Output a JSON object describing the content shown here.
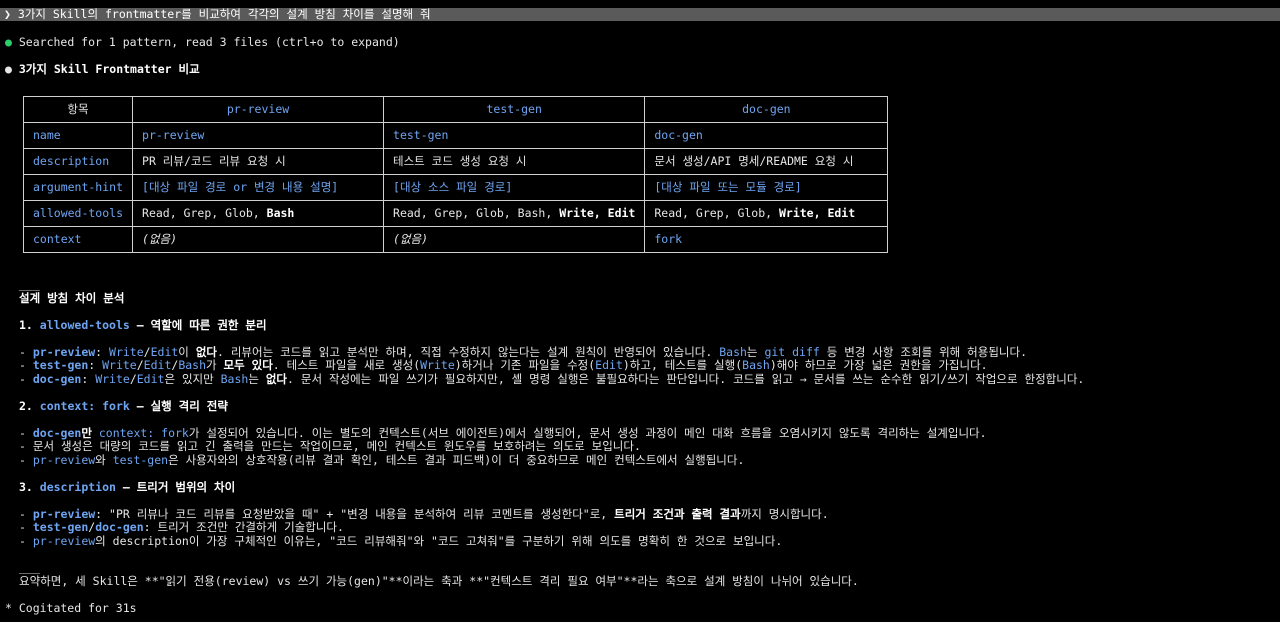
{
  "prompt": "❯ 3가지 Skill의 frontmatter를 비교하여 각각의 설계 방침 차이를 설명해 줘",
  "status_line": "Searched for 1 pattern, read 3 files (ctrl+o to expand)",
  "heading": "3가지 Skill Frontmatter 비교",
  "table": {
    "headers": [
      "항목",
      "pr-review",
      "test-gen",
      "doc-gen"
    ],
    "rows": [
      {
        "key": "name",
        "cells": [
          "pr-review",
          "test-gen",
          "doc-gen"
        ]
      },
      {
        "key": "description",
        "cells": [
          "PR 리뷰/코드 리뷰 요청 시",
          "테스트 코드 생성 요청 시",
          "문서 생성/API 명세/README 요청 시"
        ]
      },
      {
        "key": "argument-hint",
        "cells": [
          "[대상 파일 경로 or 변경 내용 설명]",
          "[대상 소스 파일 경로]",
          "[대상 파일 또는 모듈 경로]"
        ]
      },
      {
        "key": "allowed-tools",
        "cells": [
          "Read, Grep, Glob, ",
          "Read, Grep, Glob, Bash, ",
          "Read, Grep, Glob, "
        ],
        "bold": [
          "Bash",
          "Write, Edit",
          "Write, Edit"
        ]
      },
      {
        "key": "context",
        "cells": [
          "(없음)",
          "(없음)",
          "fork"
        ]
      }
    ]
  },
  "rule": "___",
  "section_title": "설계 방침 차이 분석",
  "s1": {
    "num": "1. ",
    "key": "allowed-tools",
    "title": " — 역할에 따른 권한 분리",
    "l1": {
      "a": "pr-review",
      "b": "Write",
      "c": "Edit",
      "d": "이 ",
      "e": "없다",
      "f": ". 리뷰어는 코드를 읽고 분석만 하며, 직접 수정하지 않는다는 설계 원칙이 반영되어 있습니다. ",
      "g": "Bash",
      "h": "는 ",
      "i": "git diff",
      "j": " 등 변경 사항 조회를 위해 허용됩니다."
    },
    "l2": {
      "a": "test-gen",
      "b": "Write",
      "c": "Edit",
      "d": "Bash",
      "e": "가 ",
      "f": "모두 있다",
      "g": ". 테스트 파일을 새로 생성(",
      "h": "Write",
      "i": ")하거나 기존 파일을 수정(",
      "j": "Edit",
      "k": ")하고, 테스트를 실행(",
      "l": "Bash",
      "m": ")해야 하므로 가장 넓은 권한을 가집니다."
    },
    "l3": {
      "a": "doc-gen",
      "b": "Write",
      "c": "Edit",
      "d": "은 있지만 ",
      "e": "Bash",
      "f": "는 ",
      "g": "없다",
      "h": ". 문서 작성에는 파일 쓰기가 필요하지만, 셸 명령 실행은 불필요하다는 판단입니다. 코드를 읽고 → 문서를 쓰는 순수한 읽기/쓰기 작업으로 한정합니다."
    }
  },
  "s2": {
    "num": "2. ",
    "key": "context: fork",
    "title": " — 실행 격리 전략",
    "l1": {
      "a": "doc-gen",
      "b": "만 ",
      "c": "context: fork",
      "d": "가 설정되어 있습니다. 이는 별도의 컨텍스트(서브 에이전트)에서 실행되어, 문서 생성 과정이 메인 대화 흐름을 오염시키지 않도록 격리하는 설계입니다."
    },
    "l2": "문서 생성은 대량의 코드를 읽고 긴 출력을 만드는 작업이므로, 메인 컨텍스트 윈도우를 보호하려는 의도로 보입니다.",
    "l3": {
      "a": "pr-review",
      "b": "와 ",
      "c": "test-gen",
      "d": "은 사용자와의 상호작용(리뷰 결과 확인, 테스트 결과 피드백)이 더 중요하므로 메인 컨텍스트에서 실행됩니다."
    }
  },
  "s3": {
    "num": "3. ",
    "key": "description",
    "title": " — 트리거 범위의 차이",
    "l1": {
      "a": "pr-review",
      "b": ": \"PR 리뷰나 코드 리뷰를 요청받았을 때\" + \"변경 내용을 분석하여 리뷰 코멘트를 생성한다\"로, ",
      "c": "트리거 조건과 출력 결과",
      "d": "까지 명시합니다."
    },
    "l2": {
      "a": "test-gen",
      "b": "/",
      "c": "doc-gen",
      "d": ": 트리거 조건만 간결하게 기술합니다."
    },
    "l3": {
      "a": "pr-review",
      "b": "의 description이 가장 구체적인 이유는, \"코드 리뷰해줘\"와 \"코드 고쳐줘\"를 구분하기 위해 의도를 명확히 한 것으로 보입니다."
    }
  },
  "summary": "요약하면, 세 Skill은 **\"읽기 전용(review) vs 쓰기 가능(gen)\"**이라는 축과 **\"컨텍스트 격리 필요 여부\"**라는 축으로 설계 방침이 나뉘어 있습니다.",
  "footer": "* Cogitated for 31s"
}
